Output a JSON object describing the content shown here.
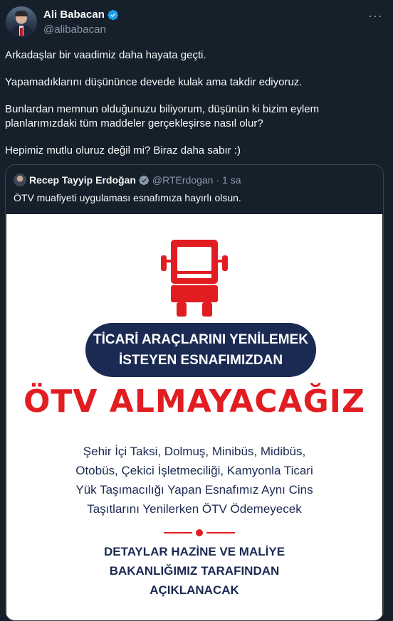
{
  "author": {
    "name": "Ali Babacan",
    "handle": "@alibabacan"
  },
  "tweet": {
    "paragraphs": [
      "Arkadaşlar bir vaadimiz daha hayata geçti.",
      "Yapamadıklarını düşününce devede kulak ama takdir ediyoruz.",
      "Bunlardan memnun olduğunuzu biliyorum, düşünün ki bizim eylem planlarımızdaki tüm maddeler gerçekleşirse nasıl olur?",
      "Hepimiz mutlu oluruz değil mi? Biraz daha sabır :)"
    ]
  },
  "quoted": {
    "name": "Recep Tayyip Erdoğan",
    "handle": "@RTErdogan",
    "time": "· 1 sa",
    "text": "ÖTV muafiyeti uygulaması esnafımıza hayırlı olsun."
  },
  "poster": {
    "pill_line1": "TİCARİ ARAÇLARINI YENİLEMEK",
    "pill_line2": "İSTEYEN ESNAFIMIZDAN",
    "headline": "ÖTV ALMAYACAĞIZ",
    "desc_lines": [
      "Şehir İçi Taksi, Dolmuş, Minibüs, Midibüs,",
      "Otobüs, Çekici İşletmeciliği, Kamyonla Ticari",
      "Yük Taşımacılığı Yapan Esnafımız Aynı Cins",
      "Taşıtlarını Yenilerken ÖTV Ödemeyecek"
    ],
    "footer_lines": [
      "DETAYLAR HAZİNE VE MALİYE",
      "BAKANLIĞIMIZ TARAFINDAN",
      "AÇIKLANACAK"
    ]
  },
  "colors": {
    "background": "#15202b",
    "verified": "#1d9bf0",
    "poster_red": "#e11d22",
    "poster_navy": "#1b2a52"
  },
  "icons": [
    "verified-badge-icon",
    "more-options-icon",
    "truck-icon"
  ]
}
